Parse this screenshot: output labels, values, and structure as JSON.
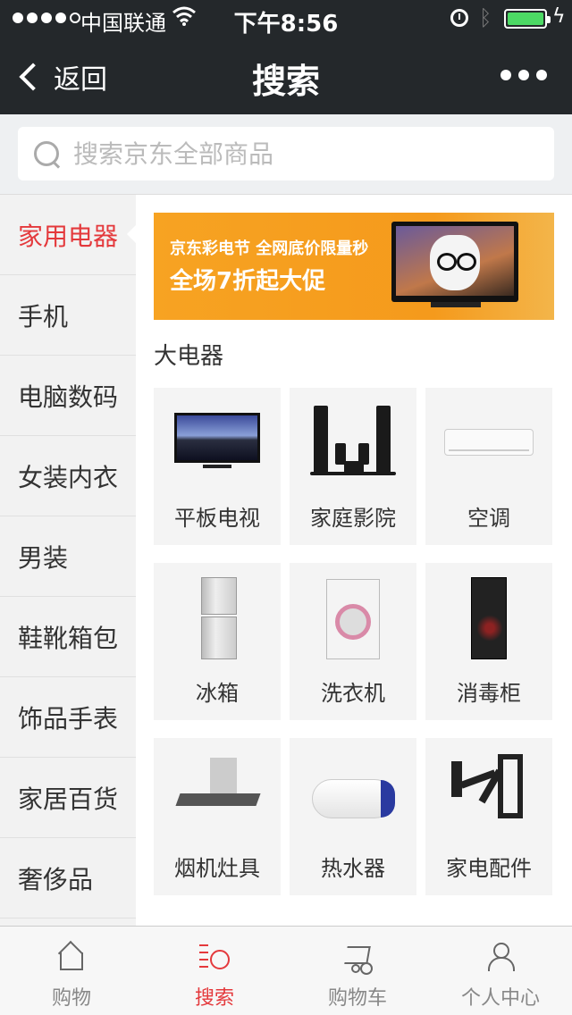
{
  "status_bar": {
    "carrier": "中国联通",
    "time": "下午8:56",
    "battery_level": 1.0
  },
  "nav": {
    "back_label": "返回",
    "title": "搜索"
  },
  "search": {
    "placeholder": "搜索京东全部商品"
  },
  "sidebar": {
    "items": [
      {
        "label": "家用电器",
        "active": true
      },
      {
        "label": "手机"
      },
      {
        "label": "电脑数码"
      },
      {
        "label": "女装内衣"
      },
      {
        "label": "男装"
      },
      {
        "label": "鞋靴箱包"
      },
      {
        "label": "饰品手表"
      },
      {
        "label": "家居百货"
      },
      {
        "label": "奢侈品"
      }
    ]
  },
  "banner": {
    "line1": "京东彩电节 全网底价限量秒",
    "line2": "全场7折起大促"
  },
  "section": {
    "title": "大电器",
    "items": [
      {
        "label": "平板电视",
        "icon": "tv-icon"
      },
      {
        "label": "家庭影院",
        "icon": "home-theater-icon"
      },
      {
        "label": "空调",
        "icon": "air-conditioner-icon"
      },
      {
        "label": "冰箱",
        "icon": "fridge-icon"
      },
      {
        "label": "洗衣机",
        "icon": "washer-icon"
      },
      {
        "label": "消毒柜",
        "icon": "sterilizer-icon"
      },
      {
        "label": "烟机灶具",
        "icon": "range-hood-icon"
      },
      {
        "label": "热水器",
        "icon": "water-heater-icon"
      },
      {
        "label": "家电配件",
        "icon": "tv-mount-icon"
      }
    ]
  },
  "tabbar": {
    "items": [
      {
        "label": "购物",
        "icon": "home-icon"
      },
      {
        "label": "搜索",
        "icon": "search-icon",
        "active": true
      },
      {
        "label": "购物车",
        "icon": "cart-icon"
      },
      {
        "label": "个人中心",
        "icon": "user-icon"
      }
    ]
  },
  "colors": {
    "accent": "#e4393c",
    "header_bg": "#24282b",
    "banner_bg": "#f7a322"
  }
}
